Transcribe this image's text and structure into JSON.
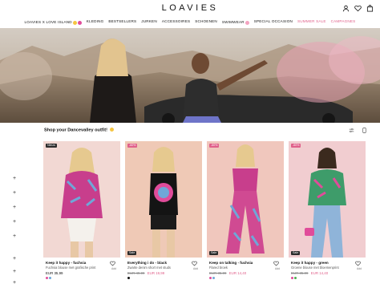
{
  "header": {
    "logo": "LOAVIES",
    "icons": [
      "user-icon",
      "heart-icon",
      "bag-icon"
    ]
  },
  "nav": {
    "items": [
      {
        "label": "LOAVIES X LOVE ISLAND",
        "sale": false
      },
      {
        "label": "KLEDING",
        "sale": false
      },
      {
        "label": "BESTSELLERS",
        "sale": false
      },
      {
        "label": "JURKEN",
        "sale": false
      },
      {
        "label": "ACCESSOIRES",
        "sale": false
      },
      {
        "label": "SCHOENEN",
        "sale": false
      },
      {
        "label": "SWIMWEAR",
        "sale": false
      },
      {
        "label": "SPECIAL OCCASION",
        "sale": false
      },
      {
        "label": "SUMMER SALE",
        "sale": true
      },
      {
        "label": "CAMPAGNES",
        "sale": true
      }
    ]
  },
  "section": {
    "title": "Shop your Dancevalley outfit!"
  },
  "products": [
    {
      "badge": "Nieuw",
      "name": "Keep it happy - fuchsia",
      "desc": "Fuchsia blouse met grafische print",
      "price_old": "",
      "price": "EUR 35,99",
      "on_sale": false,
      "add": "Add",
      "swatches": [
        "#e04c9a",
        "#6fa7d8"
      ],
      "bg": "#f2d8d3"
    },
    {
      "badge": "-60%",
      "tag": "Sale",
      "name": "Everything i do - black",
      "desc": "Zwarte denim short met studs",
      "price_old": "EUR 49,99",
      "price": "EUR 19,99",
      "on_sale": true,
      "add": "Add",
      "swatches": [
        "#111111"
      ],
      "bg": "#efc9b6"
    },
    {
      "badge": "-60%",
      "tag": "Sale",
      "name": "Keep on talking - fuchsia",
      "desc": "Flared broek",
      "price_old": "EUR 35,99",
      "price": "EUR 14,40",
      "on_sale": true,
      "add": "Add",
      "swatches": [
        "#e04c9a",
        "#6fa7d8"
      ],
      "bg": "#f0c7bd"
    },
    {
      "badge": "-60%",
      "tag": "Sale",
      "name": "Keep it happy - green",
      "desc": "Groene blouse met bloemenprint",
      "price_old": "EUR 35,99",
      "price": "EUR 14,40",
      "on_sale": true,
      "add": "Add",
      "swatches": [
        "#e04c9a",
        "#4caf50"
      ],
      "bg": "#f1cdd0"
    }
  ],
  "filters": [
    "+",
    "+",
    "+",
    "+",
    "+",
    "+",
    "+",
    "+"
  ],
  "colors": {
    "accent": "#e0608a",
    "text": "#111111"
  }
}
